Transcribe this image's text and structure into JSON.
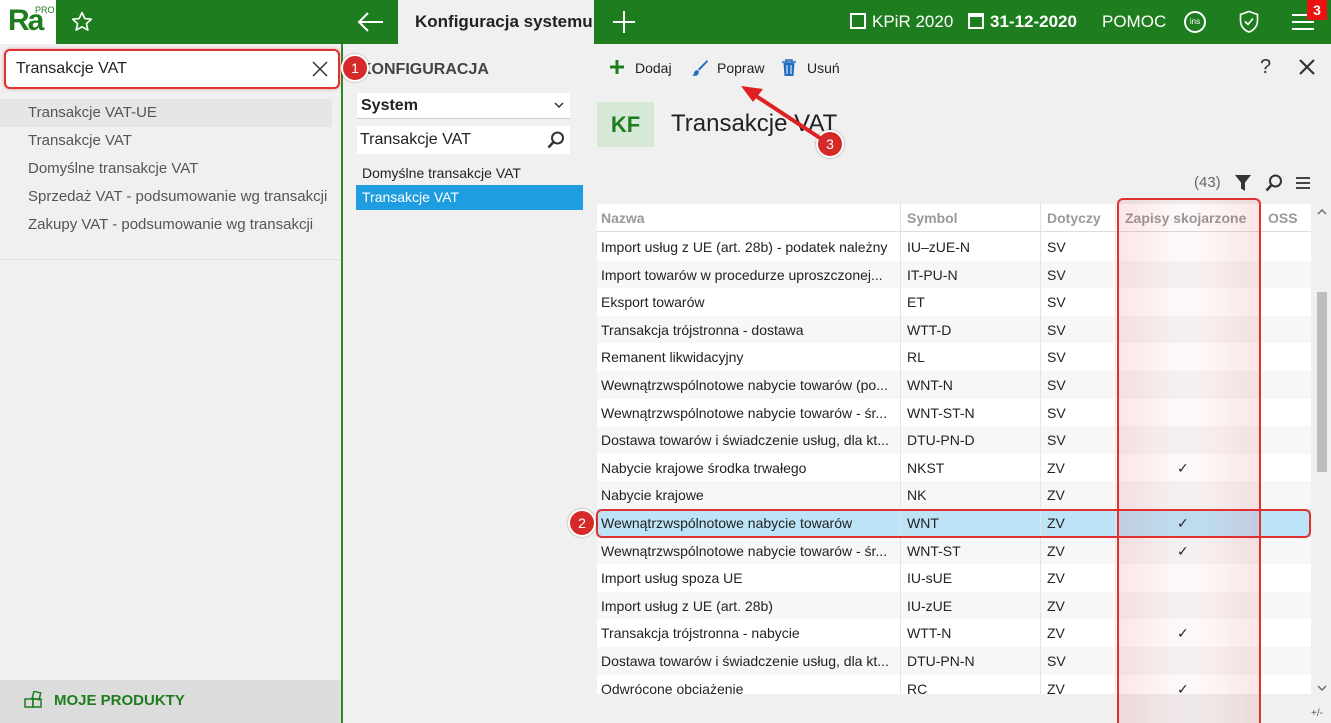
{
  "app": {
    "logo_text": "Ra",
    "logo_sup": "PRO",
    "active_tab": "Konfiguracja systemu",
    "book": "KPiR 2020",
    "date": "31-12-2020",
    "help": "POMOC",
    "ins_label": "ins",
    "notification_count": "3"
  },
  "left": {
    "search_value": "Transakcje VAT",
    "results": [
      "Transakcje VAT-UE",
      "Transakcje VAT",
      "Domyślne transakcje VAT",
      "Sprzedaż VAT - podsumowanie wg transakcji",
      "Zakupy VAT - podsumowanie wg transakcji"
    ],
    "footer": "MOJE PRODUKTY"
  },
  "middle": {
    "title": "KONFIGURACJA",
    "select_value": "System",
    "search_value": "Transakcje VAT",
    "items": [
      "Domyślne transakcje VAT",
      "Transakcje VAT"
    ]
  },
  "right": {
    "toolbar": {
      "add": "Dodaj",
      "edit": "Popraw",
      "delete": "Usuń",
      "help": "?"
    },
    "badge": "KF",
    "title": "Transakcje VAT",
    "count": "(43)",
    "columns": [
      "Nazwa",
      "Symbol",
      "Dotyczy",
      "Zapisy skojarzone",
      "OSS"
    ],
    "rows": [
      {
        "nazwa": "Import usług z UE (art. 28b) - podatek należny",
        "symbol": "IU–zUE-N",
        "dotyczy": "SV",
        "zapisy": ""
      },
      {
        "nazwa": "Import towarów w procedurze uproszczonej...",
        "symbol": "IT-PU-N",
        "dotyczy": "SV",
        "zapisy": ""
      },
      {
        "nazwa": "Eksport towarów",
        "symbol": "ET",
        "dotyczy": "SV",
        "zapisy": ""
      },
      {
        "nazwa": "Transakcja trójstronna - dostawa",
        "symbol": "WTT-D",
        "dotyczy": "SV",
        "zapisy": ""
      },
      {
        "nazwa": "Remanent likwidacyjny",
        "symbol": "RL",
        "dotyczy": "SV",
        "zapisy": ""
      },
      {
        "nazwa": "Wewnątrzwspólnotowe nabycie towarów (po...",
        "symbol": "WNT-N",
        "dotyczy": "SV",
        "zapisy": ""
      },
      {
        "nazwa": "Wewnątrzwspólnotowe nabycie towarów - śr...",
        "symbol": "WNT-ST-N",
        "dotyczy": "SV",
        "zapisy": ""
      },
      {
        "nazwa": "Dostawa towarów i świadczenie usług, dla kt...",
        "symbol": "DTU-PN-D",
        "dotyczy": "SV",
        "zapisy": ""
      },
      {
        "nazwa": "Nabycie krajowe środka trwałego",
        "symbol": "NKST",
        "dotyczy": "ZV",
        "zapisy": "✓"
      },
      {
        "nazwa": "Nabycie krajowe",
        "symbol": "NK",
        "dotyczy": "ZV",
        "zapisy": ""
      },
      {
        "nazwa": "Wewnątrzwspólnotowe nabycie towarów",
        "symbol": "WNT",
        "dotyczy": "ZV",
        "zapisy": "✓"
      },
      {
        "nazwa": "Wewnątrzwspólnotowe nabycie towarów - śr...",
        "symbol": "WNT-ST",
        "dotyczy": "ZV",
        "zapisy": "✓"
      },
      {
        "nazwa": "Import usług spoza UE",
        "symbol": "IU-sUE",
        "dotyczy": "ZV",
        "zapisy": ""
      },
      {
        "nazwa": "Import usług z UE (art. 28b)",
        "symbol": "IU-zUE",
        "dotyczy": "ZV",
        "zapisy": ""
      },
      {
        "nazwa": "Transakcja trójstronna - nabycie",
        "symbol": "WTT-N",
        "dotyczy": "ZV",
        "zapisy": "✓"
      },
      {
        "nazwa": "Dostawa towarów i świadczenie usług, dla kt...",
        "symbol": "DTU-PN-N",
        "dotyczy": "SV",
        "zapisy": ""
      },
      {
        "nazwa": "Odwrócone obciążenie",
        "symbol": "RC",
        "dotyczy": "ZV",
        "zapisy": "✓"
      }
    ],
    "selected_row": 10,
    "plusminus": "+/-"
  },
  "annotations": {
    "m1": "1",
    "m2": "2",
    "m3": "3"
  },
  "colors": {
    "brand": "#1e7d1e",
    "selection": "#1e9ee0",
    "row_selected": "#bde3f7",
    "annotation": "#e03030"
  }
}
